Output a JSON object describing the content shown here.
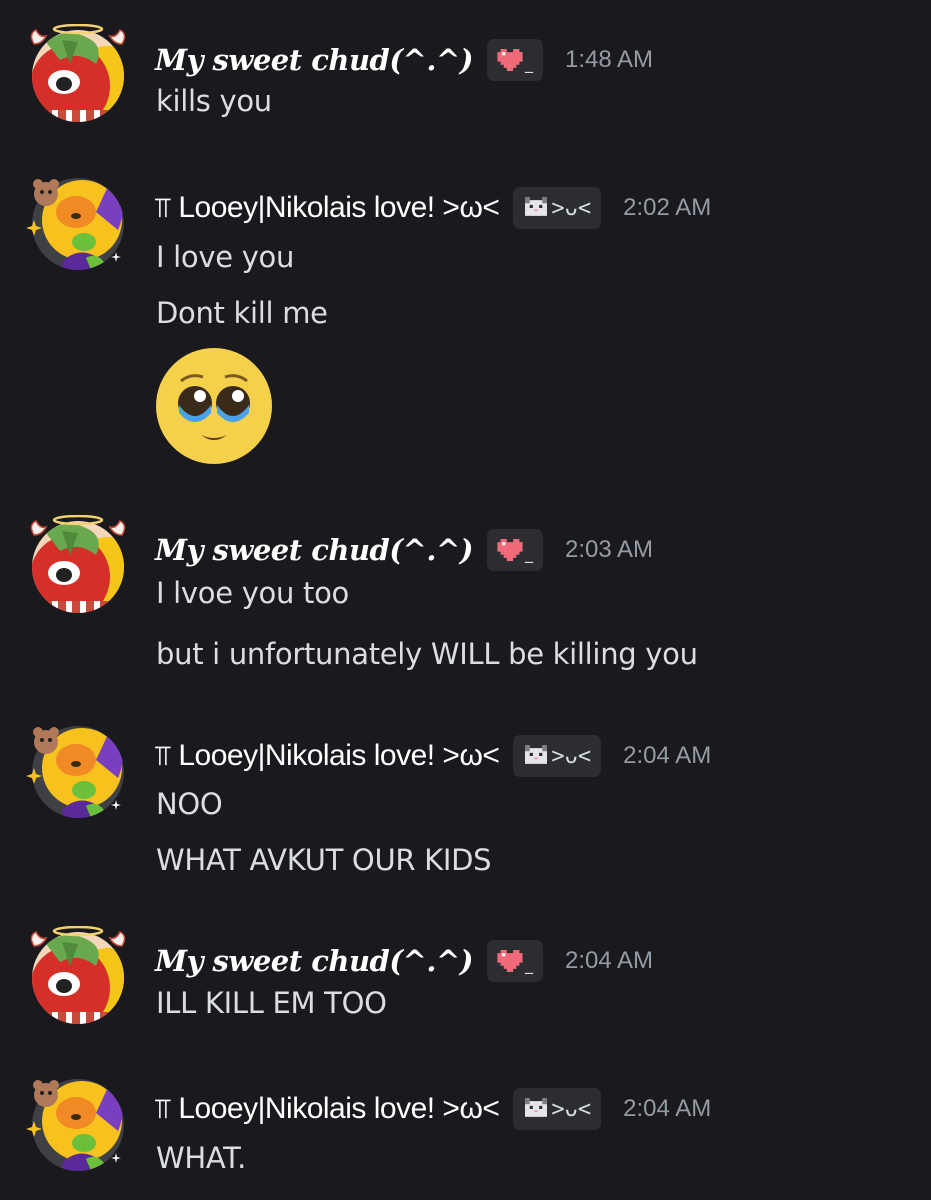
{
  "users": {
    "chud": {
      "name": "My sweet chud(^.^)",
      "tag_icon": "pixel-heart-icon",
      "tag_suffix": "_"
    },
    "looey": {
      "symbol": "⫪",
      "name": "Looey|Nikolais love! >ω<",
      "tag_icon": "pixel-cat-icon",
      "tag_text": ">ᴗ<"
    }
  },
  "colors": {
    "background": "#1a1a1e",
    "username": "#ffffff",
    "message_text": "#dbdee1",
    "timestamp": "#949ba4",
    "tag_background": "#2b2d31"
  },
  "messages": [
    {
      "author": "My sweet chud(^.^)",
      "time": "1:48 AM",
      "lines": [
        "kills you"
      ]
    },
    {
      "author": "Looey|Nikolais love! >ω<",
      "time": "2:02 AM",
      "lines": [
        "I love you",
        "Dont kill me"
      ],
      "emoji": "pleading-face-emoji"
    },
    {
      "author": "My sweet chud(^.^)",
      "time": "2:03 AM",
      "lines": [
        "I lvoe you too",
        "but i unfortunately WILL be killing you"
      ]
    },
    {
      "author": "Looey|Nikolais love! >ω<",
      "time": "2:04 AM",
      "lines": [
        "NOO",
        "WHAT AVKUT OUR KIDS"
      ]
    },
    {
      "author": "My sweet chud(^.^)",
      "time": "2:04 AM",
      "lines": [
        "ILL KILL EM TOO"
      ]
    },
    {
      "author": "Looey|Nikolais love! >ω<",
      "time": "2:04 AM",
      "lines": [
        "WHAT."
      ]
    }
  ]
}
